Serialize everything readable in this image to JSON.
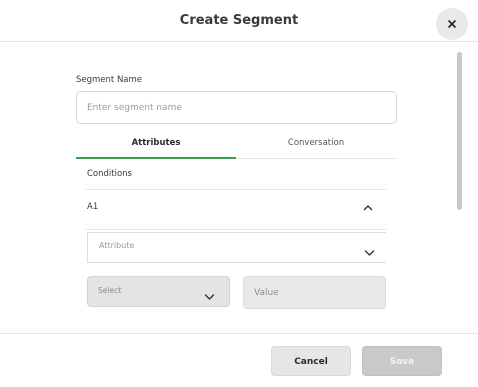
{
  "dialog": {
    "title": "Create Segment",
    "close_icon": "close-icon"
  },
  "form": {
    "segment_name_label": "Segment Name",
    "segment_name_placeholder": "Enter segment name",
    "segment_name_value": ""
  },
  "tabs": [
    {
      "label": "Attributes",
      "active": true
    },
    {
      "label": "Conversation",
      "active": false
    }
  ],
  "conditions": {
    "label": "Conditions",
    "group_label": "A1",
    "collapse_icon": "chevron-up-icon",
    "attribute_placeholder": "Attribute",
    "operator_placeholder": "Select",
    "value_placeholder": "Value",
    "dropdown_icon": "chevron-down-icon"
  },
  "footer": {
    "cancel_label": "Cancel",
    "save_label": "Save"
  },
  "colors": {
    "accent": "#3aa14a",
    "save_disabled_bg": "#c9c9c9",
    "cancel_bg": "#e6e6e6"
  }
}
